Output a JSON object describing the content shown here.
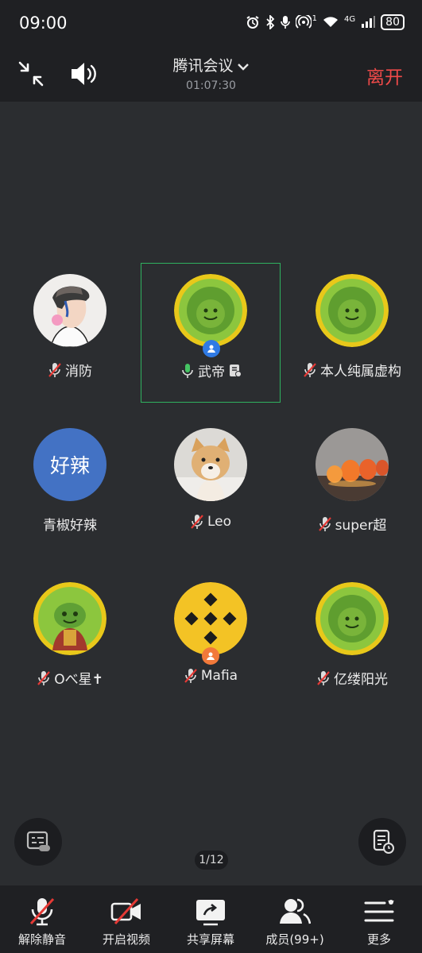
{
  "status_bar": {
    "time": "09:00",
    "network": "4G",
    "signal_superscript": "1",
    "battery": "80",
    "icons": [
      "alarm-icon",
      "bluetooth-icon",
      "mic-icon",
      "hotspot-icon",
      "wifi-icon",
      "cell-signal-icon",
      "battery-icon"
    ]
  },
  "header": {
    "title": "腾讯会议",
    "timer": "01:07:30",
    "leave_label": "离开"
  },
  "participants": [
    {
      "name": "消防",
      "mic": "muted",
      "avatar": "anime-boy"
    },
    {
      "name": "武帝",
      "mic": "active",
      "avatar": "green-coin",
      "active": true,
      "badge": "blue"
    },
    {
      "name": "本人纯属虚构",
      "mic": "muted",
      "avatar": "green-coin"
    },
    {
      "name": "青椒好辣",
      "mic": "none",
      "avatar": "text",
      "avatar_text": "好辣",
      "avatar_color": "#4372c4"
    },
    {
      "name": "Leo",
      "mic": "muted",
      "avatar": "dog"
    },
    {
      "name": "super超",
      "mic": "muted",
      "avatar": "balloons"
    },
    {
      "name": "Oべ星✝",
      "mic": "muted",
      "avatar": "green-character"
    },
    {
      "name": "Mafia",
      "mic": "muted",
      "avatar": "binance",
      "badge": "orange"
    },
    {
      "name": "亿缕阳光",
      "mic": "muted",
      "avatar": "green-coin"
    }
  ],
  "pagination": "1/12",
  "toolbar": {
    "unmute": "解除静音",
    "video": "开启视频",
    "share": "共享屏幕",
    "members": "成员(99+)",
    "more": "更多"
  },
  "colors": {
    "background": "#2b2d30",
    "bar": "#1f2023",
    "leave": "#ef4a49",
    "active_border": "#2fb15f",
    "muted_slash": "#e53935"
  }
}
